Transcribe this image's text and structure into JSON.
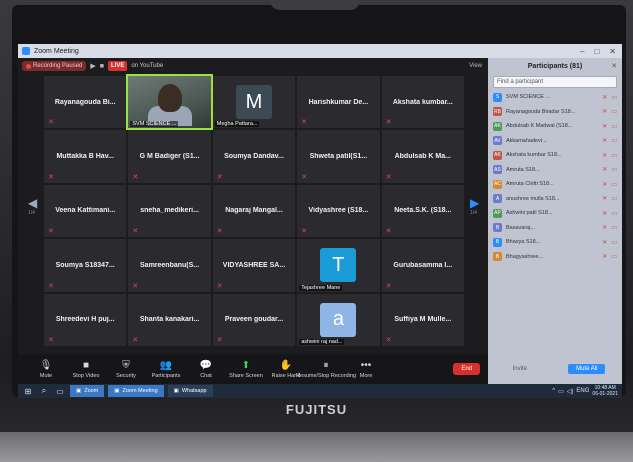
{
  "window": {
    "title": "Zoom Meeting"
  },
  "topbar": {
    "recording_label": "Recording Paused",
    "live_label": "LIVE",
    "live_text": "on YouTube",
    "view_label": "View"
  },
  "grid": {
    "tiles": [
      {
        "kind": "name",
        "name": "Rayanagouda Bi..."
      },
      {
        "kind": "video",
        "name": "SVM SCIENCE ..."
      },
      {
        "kind": "avatar",
        "letter": "M",
        "color": "#3c4a54",
        "name": "Megha Pattara..."
      },
      {
        "kind": "name",
        "name": "Harishkumar De..."
      },
      {
        "kind": "name",
        "name": "Akshata kumbar..."
      },
      {
        "kind": "name",
        "name": "Muttakka B Hav..."
      },
      {
        "kind": "name",
        "name": "G M Badiger (S1..."
      },
      {
        "kind": "name",
        "name": "Soumya Dandav..."
      },
      {
        "kind": "name",
        "name": "Shweta patil(S1..."
      },
      {
        "kind": "name",
        "name": "Abdulsab K Ma..."
      },
      {
        "kind": "name",
        "name": "Veena Kattimani..."
      },
      {
        "kind": "name",
        "name": "sneha_medikeri..."
      },
      {
        "kind": "name",
        "name": "Nagaraj Mangal..."
      },
      {
        "kind": "name",
        "name": "Vidyashree (S18..."
      },
      {
        "kind": "name",
        "name": "Neeta.S.K. (S18..."
      },
      {
        "kind": "name",
        "name": "Soumya S18347..."
      },
      {
        "kind": "name",
        "name": "Samreenbanu(S..."
      },
      {
        "kind": "name",
        "name": "VIDYASHREE SA..."
      },
      {
        "kind": "avatar",
        "letter": "T",
        "color": "#1a9bd6",
        "name": "Tejashree Mane"
      },
      {
        "kind": "name",
        "name": "Gurubasamma I..."
      },
      {
        "kind": "name",
        "name": "Shreedevi H puj..."
      },
      {
        "kind": "name",
        "name": "Shanta kanakari..."
      },
      {
        "kind": "name",
        "name": "Praveen goudar..."
      },
      {
        "kind": "avatar",
        "letter": "a",
        "color": "#8fb4e6",
        "name": "ashwini raj nad..."
      },
      {
        "kind": "name",
        "name": "Suffiya M Mulle..."
      }
    ]
  },
  "controls": {
    "items": [
      {
        "icon": "🎙",
        "label": "Mute",
        "name": "mute"
      },
      {
        "icon": "■",
        "label": "Stop Video",
        "name": "stop-video"
      },
      {
        "icon": "⛨",
        "label": "Security",
        "name": "security"
      },
      {
        "icon": "👥",
        "label": "Participants",
        "name": "participants"
      },
      {
        "icon": "💬",
        "label": "Chat",
        "name": "chat"
      },
      {
        "icon": "⬆",
        "label": "Share Screen",
        "name": "share-screen"
      },
      {
        "icon": "✋",
        "label": "Raise Hand",
        "name": "raise-hand"
      },
      {
        "icon": "⏸",
        "label": "Resume/Stop Recording",
        "name": "recording"
      },
      {
        "icon": "•••",
        "label": "More",
        "name": "more"
      }
    ],
    "end_label": "End"
  },
  "panel": {
    "title": "Participants (81)",
    "search_placeholder": "Find a participant",
    "participants": [
      {
        "initials": "S",
        "color": "#2d8cff",
        "name": "SVM SCIENCE ..."
      },
      {
        "initials": "RB",
        "color": "#c0564a",
        "name": "Rayanagouda Biradar S18..."
      },
      {
        "initials": "AK",
        "color": "#4f9a58",
        "name": "Abdulsab K Madwal (S18..."
      },
      {
        "initials": "AV",
        "color": "#6c7bd0",
        "name": "Akkamahadevi..."
      },
      {
        "initials": "AK",
        "color": "#c0564a",
        "name": "Akshata kumbar S18..."
      },
      {
        "initials": "AS",
        "color": "#6c7bd0",
        "name": "Amruta S18..."
      },
      {
        "initials": "AC",
        "color": "#d08b3a",
        "name": "Amruta Chitti S18..."
      },
      {
        "initials": "A",
        "color": "#6c7bd0",
        "name": "anushree mulla S18..."
      },
      {
        "initials": "AP",
        "color": "#4f9a58",
        "name": "Ashwini patil S18..."
      },
      {
        "initials": "B",
        "color": "#6c7bd0",
        "name": "Basavaraj..."
      },
      {
        "initials": "B",
        "color": "#2d8cff",
        "name": "Bhavya S18..."
      },
      {
        "initials": "B",
        "color": "#d08b3a",
        "name": "Bhagyashree..."
      }
    ],
    "invite_label": "Invite",
    "mute_all_label": "Mute All"
  },
  "taskbar": {
    "apps": [
      {
        "label": "Zoom",
        "name": "zoom"
      },
      {
        "label": "Zoom Meeting",
        "name": "zoom-meeting"
      },
      {
        "label": "Whatsapp",
        "name": "whatsapp"
      }
    ],
    "time": "10:48 AM",
    "date": "06-01-2021",
    "lang": "ENG"
  },
  "brand": {
    "logo_text": "FUJITSU"
  }
}
